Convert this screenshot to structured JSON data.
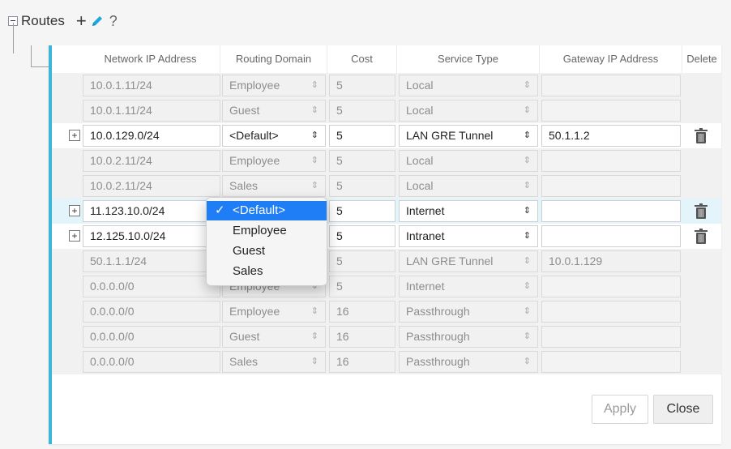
{
  "section": {
    "title": "Routes",
    "add_icon": "+",
    "help_icon": "?"
  },
  "columns": [
    "Network IP Address",
    "Routing Domain",
    "Cost",
    "Service Type",
    "Gateway IP Address",
    "Delete"
  ],
  "rows": [
    {
      "ip": "10.0.1.11/24",
      "domain": "Employee",
      "cost": "5",
      "service": "Local",
      "gateway": "",
      "editable": false,
      "expand": false,
      "delete": false
    },
    {
      "ip": "10.0.1.11/24",
      "domain": "Guest",
      "cost": "5",
      "service": "Local",
      "gateway": "",
      "editable": false,
      "expand": false,
      "delete": false
    },
    {
      "ip": "10.0.129.0/24",
      "domain": "<Default>",
      "cost": "5",
      "service": "LAN GRE Tunnel",
      "gateway": "50.1.1.2",
      "editable": true,
      "expand": true,
      "delete": true
    },
    {
      "ip": "10.0.2.11/24",
      "domain": "Employee",
      "cost": "5",
      "service": "Local",
      "gateway": "",
      "editable": false,
      "expand": false,
      "delete": false
    },
    {
      "ip": "10.0.2.11/24",
      "domain": "Sales",
      "cost": "5",
      "service": "Local",
      "gateway": "",
      "editable": false,
      "expand": false,
      "delete": false
    },
    {
      "ip": "11.123.10.0/24",
      "domain": "<Default>",
      "cost": "5",
      "service": "Internet",
      "gateway": "",
      "editable": true,
      "expand": true,
      "delete": true,
      "highlight": true
    },
    {
      "ip": "12.125.10.0/24",
      "domain": "<Default>",
      "cost": "5",
      "service": "Intranet",
      "gateway": "",
      "editable": true,
      "expand": true,
      "delete": true
    },
    {
      "ip": "50.1.1.1/24",
      "domain": "<Default>",
      "cost": "5",
      "service": "LAN GRE Tunnel",
      "gateway": "10.0.1.129",
      "editable": false,
      "expand": false,
      "delete": false
    },
    {
      "ip": "0.0.0.0/0",
      "domain": "Employee",
      "cost": "5",
      "service": "Internet",
      "gateway": "",
      "editable": false,
      "expand": false,
      "delete": false
    },
    {
      "ip": "0.0.0.0/0",
      "domain": "Employee",
      "cost": "16",
      "service": "Passthrough",
      "gateway": "",
      "editable": false,
      "expand": false,
      "delete": false
    },
    {
      "ip": "0.0.0.0/0",
      "domain": "Guest",
      "cost": "16",
      "service": "Passthrough",
      "gateway": "",
      "editable": false,
      "expand": false,
      "delete": false
    },
    {
      "ip": "0.0.0.0/0",
      "domain": "Sales",
      "cost": "16",
      "service": "Passthrough",
      "gateway": "",
      "editable": false,
      "expand": false,
      "delete": false
    }
  ],
  "dropdown": {
    "options": [
      "<Default>",
      "Employee",
      "Guest",
      "Sales"
    ],
    "selected": "<Default>",
    "check_icon": "✓"
  },
  "buttons": {
    "apply": "Apply",
    "close": "Close"
  },
  "colors": {
    "accent": "#3bb6d8",
    "selection": "#1f7ef5",
    "edit_icon": "#1ea7d8"
  }
}
